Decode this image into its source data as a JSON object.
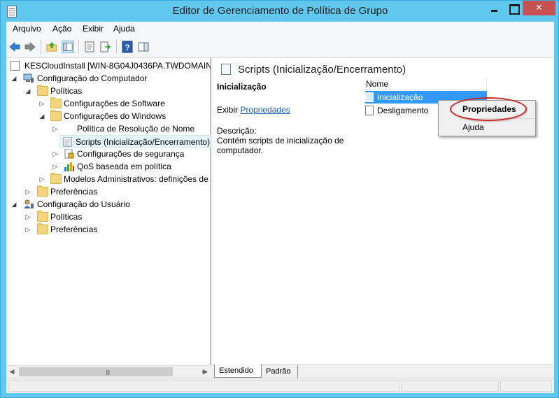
{
  "window": {
    "title": "Editor de Gerenciamento de Política de Grupo",
    "accent_color": "#5fc8ec",
    "close_color": "#c75050"
  },
  "menubar": {
    "file": "Arquivo",
    "action": "Ação",
    "view": "Exibir",
    "help": "Ajuda"
  },
  "toolbar": {
    "icons": [
      "back-icon",
      "forward-icon",
      "up-folder-icon",
      "show-hide-tree-icon",
      "properties-icon",
      "export-list-icon",
      "help-icon",
      "action-pane-icon"
    ]
  },
  "tree": {
    "root": "KESCloudInstall [WIN-8G04J0436PA.TWDOMAIN.L",
    "computer_config": "Configuração do Computador",
    "policies": "Políticas",
    "software_settings": "Configurações de Software",
    "windows_settings": "Configurações do Windows",
    "name_resolution": "Política de Resolução de Nome",
    "scripts": "Scripts (Inicialização/Encerramento)",
    "security_settings": "Configurações de segurança",
    "qos": "QoS baseada em política",
    "admin_templates": "Modelos Administrativos: definições de",
    "preferences1": "Preferências",
    "user_config": "Configuração do Usuário",
    "user_policies": "Políticas",
    "user_preferences": "Preferências"
  },
  "hscroll": {
    "grip": "III"
  },
  "detail": {
    "header": "Scripts (Inicialização/Encerramento)",
    "section_title": "Inicialização",
    "show_prefix": "Exibir",
    "properties_link": "Propriedades",
    "desc_label": "Descrição:",
    "desc_text": "Contém scripts de inicialização de computador."
  },
  "list": {
    "column": "Nome",
    "items": [
      "Inicialização",
      "Desligamento"
    ],
    "selected_color": "#3399ff"
  },
  "context_menu": {
    "items": [
      "Propriedades",
      "Ajuda"
    ],
    "highlight_color": "#c62828"
  },
  "tabs": [
    "Estendido",
    "Padrão"
  ]
}
